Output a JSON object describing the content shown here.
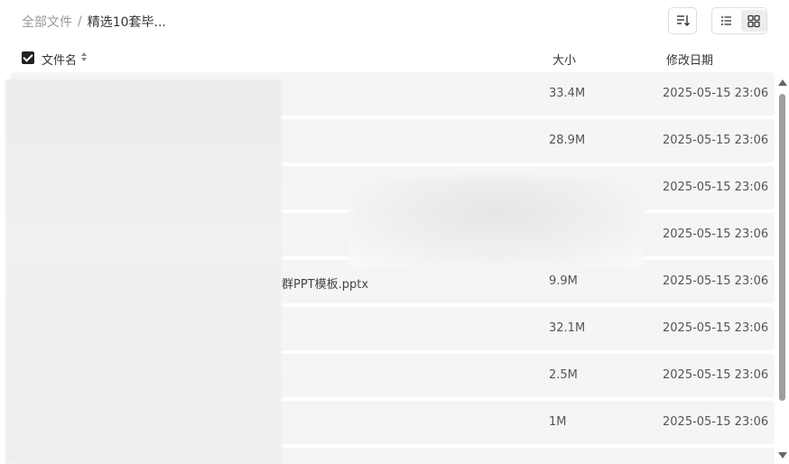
{
  "breadcrumb": {
    "root": "全部文件",
    "separator": "/",
    "current": "精选10套毕..."
  },
  "toolbar": {
    "sort_icon": "sort-lines-icon",
    "list_view_icon": "list-view-icon",
    "grid_view_icon": "grid-view-icon",
    "active_view": "grid"
  },
  "header": {
    "name": "文件名",
    "size": "大小",
    "date": "修改日期",
    "select_all_checked": true
  },
  "rows": [
    {
      "name": "",
      "size": "33.4M",
      "date": "2025-05-15 23:06"
    },
    {
      "name": "",
      "size": "28.9M",
      "date": "2025-05-15 23:06"
    },
    {
      "name": "",
      "size": "",
      "date": "2025-05-15 23:06"
    },
    {
      "name": "",
      "size": "",
      "date": "2025-05-15 23:06"
    },
    {
      "name": "群PPT模板.pptx",
      "size": "9.9M",
      "date": "2025-05-15 23:06"
    },
    {
      "name": "",
      "size": "32.1M",
      "date": "2025-05-15 23:06"
    },
    {
      "name": "",
      "size": "2.5M",
      "date": "2025-05-15 23:06"
    },
    {
      "name": "",
      "size": "1M",
      "date": "2025-05-15 23:06"
    }
  ]
}
